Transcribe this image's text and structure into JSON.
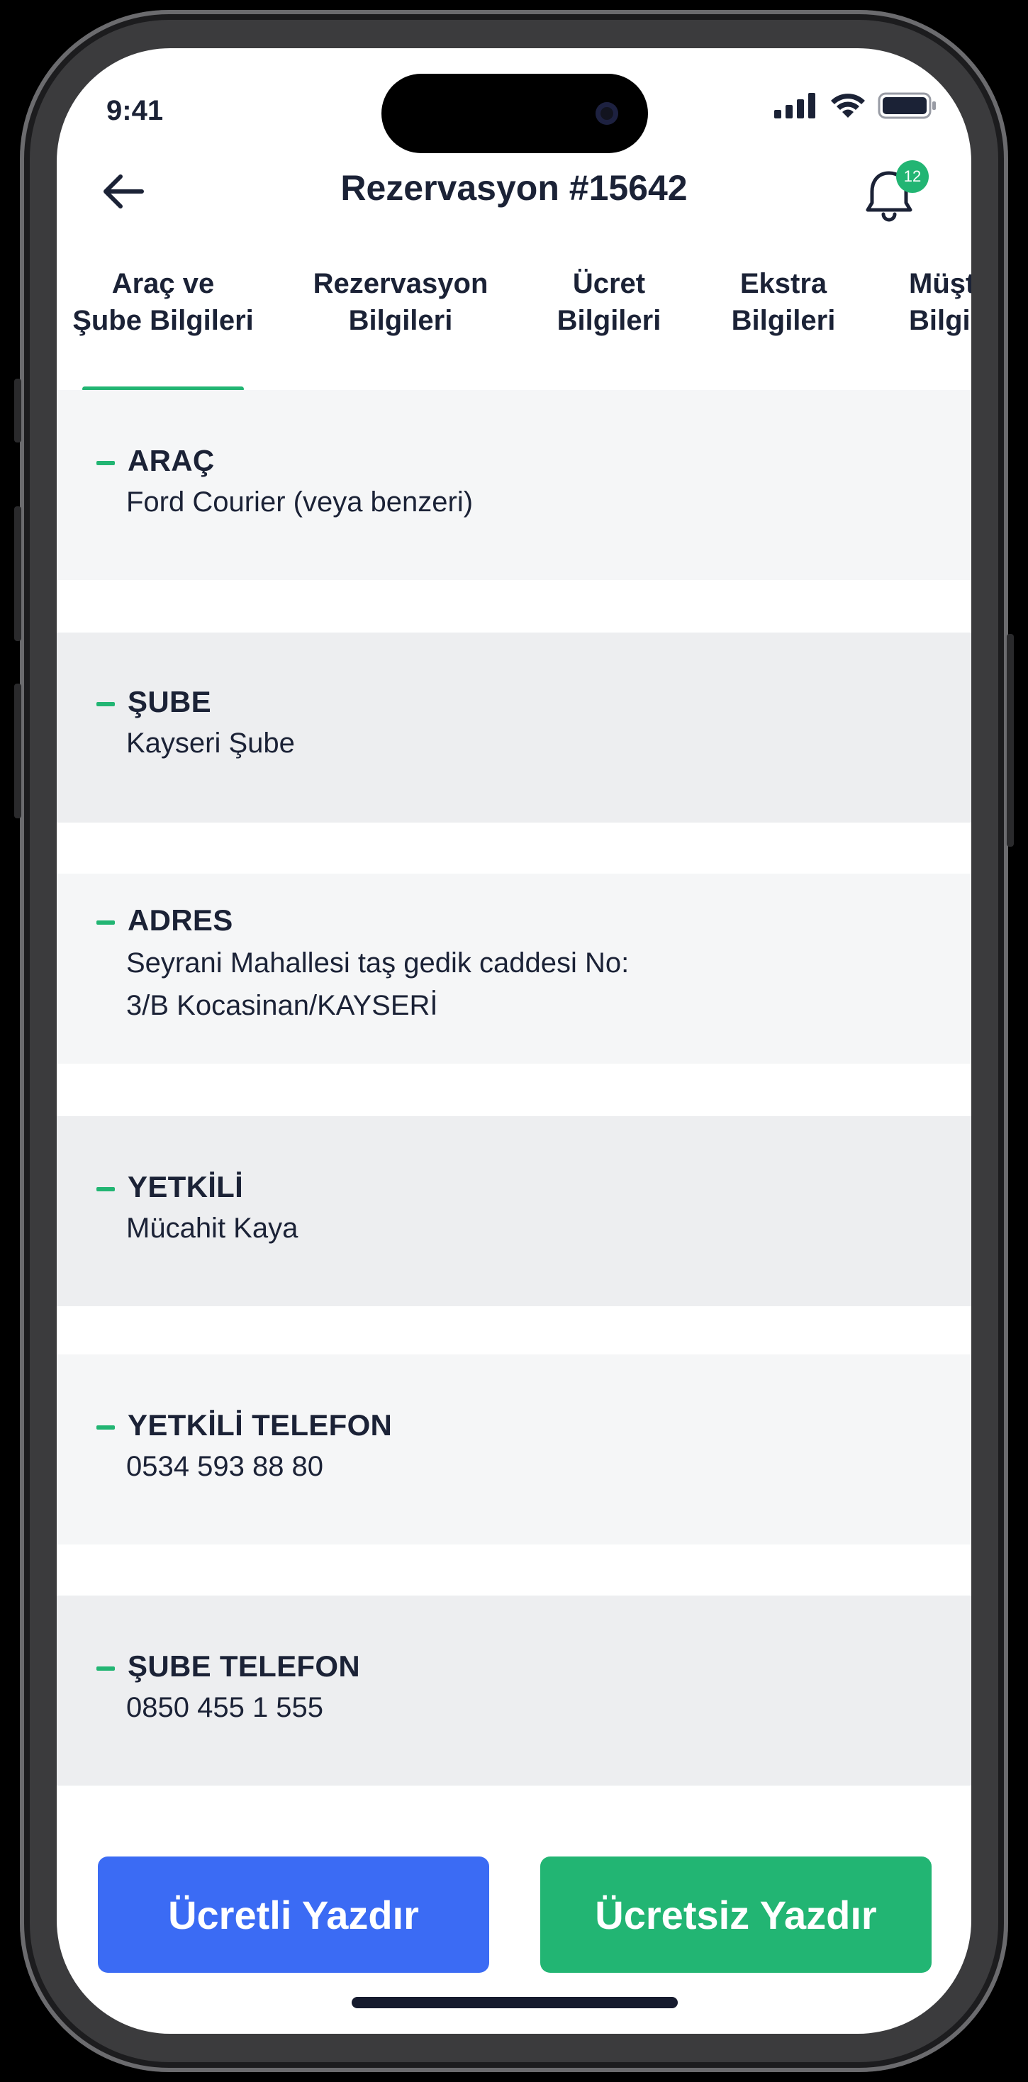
{
  "status_bar": {
    "time": "9:41"
  },
  "header": {
    "title": "Rezervasyon #15642",
    "notification_count": "12"
  },
  "tabs": [
    {
      "line1": "Araç ve",
      "line2": "Şube Bilgileri",
      "active": true
    },
    {
      "line1": "Rezervasyon",
      "line2": "Bilgileri",
      "active": false
    },
    {
      "line1": "Ücret",
      "line2": "Bilgileri",
      "active": false
    },
    {
      "line1": "Ekstra",
      "line2": "Bilgileri",
      "active": false
    },
    {
      "line1": "Müşt",
      "line2": "Bilgi",
      "active": false
    }
  ],
  "sections": [
    {
      "label": "ARAÇ",
      "lines": [
        "Ford Courier (veya benzeri)"
      ]
    },
    {
      "label": "ŞUBE",
      "lines": [
        "Kayseri Şube"
      ]
    },
    {
      "label": "ADRES",
      "lines": [
        "Seyrani Mahallesi taş gedik caddesi No:",
        "3/B Kocasinan/KAYSERİ"
      ]
    },
    {
      "label": "YETKİLİ",
      "lines": [
        "Mücahit Kaya"
      ]
    },
    {
      "label": "YETKİLİ TELEFON",
      "lines": [
        "0534 593 88 80"
      ]
    },
    {
      "label": "ŞUBE TELEFON",
      "lines": [
        "0850 455 1 555"
      ]
    }
  ],
  "buttons": {
    "paid_print": "Ücretli Yazdır",
    "free_print": "Ücretsiz Yazdır"
  },
  "colors": {
    "accent_green": "#22b573",
    "primary_blue": "#3b6bf4",
    "text_dark": "#1b2236"
  }
}
